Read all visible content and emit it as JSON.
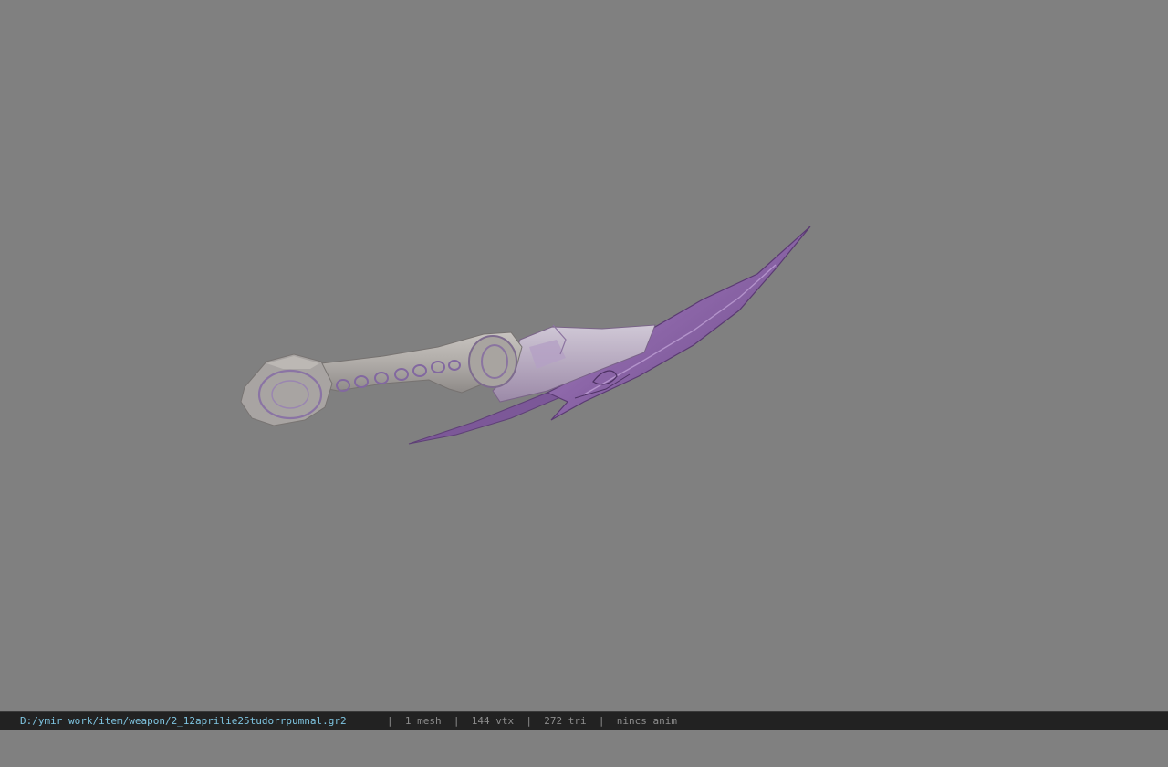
{
  "viewer": {
    "background_color": "#808080",
    "model": {
      "name": "dagger",
      "handle_color": "#b4b0ac",
      "blade_color": "#8e6aa8"
    }
  },
  "status_bar": {
    "file_path": "D:/ymir work/item/weapon/2_12aprilie25tudorrpumnal.gr2",
    "mesh_count": "1 mesh",
    "vertex_count": "144 vtx",
    "triangle_count": "272 tri",
    "animation": "nincs anim",
    "separator": "|",
    "path_color": "#7ec4e0",
    "text_color": "#8c8c8c"
  }
}
